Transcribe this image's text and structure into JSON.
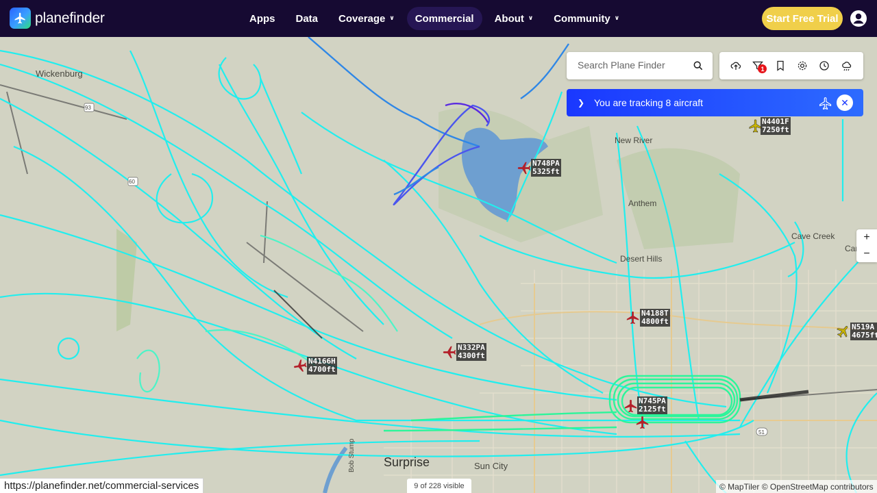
{
  "brand": {
    "name": "planefinder"
  },
  "nav": {
    "items": [
      {
        "label": "Apps",
        "dropdown": false,
        "active": false
      },
      {
        "label": "Data",
        "dropdown": false,
        "active": false
      },
      {
        "label": "Coverage",
        "dropdown": true,
        "active": false
      },
      {
        "label": "Commercial",
        "dropdown": false,
        "active": true
      },
      {
        "label": "About",
        "dropdown": true,
        "active": false
      },
      {
        "label": "Community",
        "dropdown": true,
        "active": false
      }
    ],
    "trial_button": "Start Free Trial"
  },
  "search": {
    "placeholder": "Search Plane Finder",
    "value": ""
  },
  "toolbar": {
    "icons": [
      "cloud-upload-icon",
      "filter-icon",
      "bookmark-icon",
      "gear-icon",
      "history-icon",
      "weather-icon"
    ],
    "filter_badge": "1"
  },
  "tracking": {
    "text": "You are tracking 8 aircraft"
  },
  "zoom": {
    "in": "+",
    "out": "−"
  },
  "places": [
    "Wickenburg",
    "New River",
    "Anthem",
    "Cave Creek",
    "Carefree",
    "Desert Hills",
    "Surprise",
    "Sun City",
    "Bob Stump"
  ],
  "road_shields": [
    "93",
    "60",
    "51"
  ],
  "aircraft": [
    {
      "callsign": "N4401F",
      "altitude": "7250ft",
      "color": "#c9b400"
    },
    {
      "callsign": "N748PA",
      "altitude": "5325ft",
      "color": "#b3202a"
    },
    {
      "callsign": "N4188T",
      "altitude": "4800ft",
      "color": "#b3202a"
    },
    {
      "callsign": "N519A",
      "altitude": "4675ft",
      "color": "#c9b400"
    },
    {
      "callsign": "N332PA",
      "altitude": "4300ft",
      "color": "#b3202a"
    },
    {
      "callsign": "N4166H",
      "altitude": "4700ft",
      "color": "#b3202a"
    },
    {
      "callsign": "N745PA",
      "altitude": "2125ft",
      "color": "#b3202a"
    }
  ],
  "status": {
    "url": "https://planefinder.net/commercial-services",
    "visible_count": "9 of 228 visible",
    "attribution": "© MapTiler © OpenStreetMap contributors"
  },
  "colors": {
    "header_bg": "#160a32",
    "trial_button": "#f0cf4a",
    "tracking_bar": "#1a38ff",
    "track_cyan": "#1ff0f0",
    "track_green": "#2cf59a",
    "lake": "#6e9fd0"
  }
}
